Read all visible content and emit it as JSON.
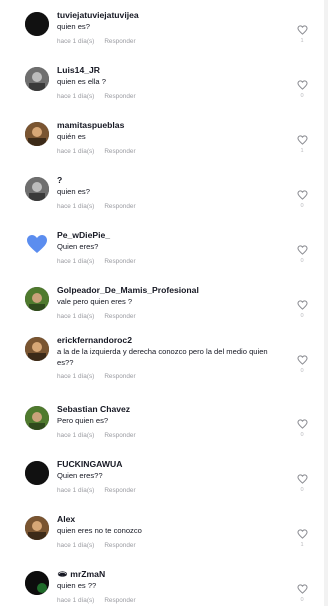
{
  "comments": [
    {
      "username": "tuviejatuviejatuvijea",
      "text": "quien es?",
      "time": "hace 1 día(s)",
      "reply": "Responder",
      "likes": "1",
      "avatar": "dark"
    },
    {
      "username": "Luis14_JR",
      "text": "quien es ella ?",
      "time": "hace 1 día(s)",
      "reply": "Responder",
      "likes": "0",
      "avatar": "photo-gray"
    },
    {
      "username": "mamitaspueblas",
      "text": "quién es",
      "time": "hace 1 día(s)",
      "reply": "Responder",
      "likes": "1",
      "avatar": "photo-brown"
    },
    {
      "username": "?",
      "text": "quien es?",
      "time": "hace 1 día(s)",
      "reply": "Responder",
      "likes": "0",
      "avatar": "photo-gray"
    },
    {
      "username": "Pe_wDiePie_",
      "text": "Quien eres?",
      "time": "hace 1 día(s)",
      "reply": "Responder",
      "likes": "0",
      "avatar": "heart-blue"
    },
    {
      "username": "Golpeador_De_Mamis_Profesional",
      "text": "vale pero quien eres ?",
      "time": "hace 1 día(s)",
      "reply": "Responder",
      "likes": "0",
      "avatar": "photo-green"
    },
    {
      "username": "erickfernandoroc2",
      "text": "a la de la izquierda y derecha conozco pero la del medio quien es??",
      "time": "hace 1 día(s)",
      "reply": "Responder",
      "likes": "0",
      "avatar": "photo-brown"
    },
    {
      "username": "Sebastian Chavez",
      "text": "Pero quien es?",
      "time": "hace 1 día(s)",
      "reply": "Responder",
      "likes": "0",
      "avatar": "photo-green"
    },
    {
      "username": "FUCKINGAWUA",
      "text": "Quien eres??",
      "time": "hace 1 día(s)",
      "reply": "Responder",
      "likes": "0",
      "avatar": "dark"
    },
    {
      "username": "Alex",
      "text": "quien eres no te conozco",
      "time": "hace 1 día(s)",
      "reply": "Responder",
      "likes": "1",
      "avatar": "photo-brown"
    },
    {
      "username": "🕳 mrZmaN",
      "text": "quien es ??",
      "time": "hace 1 día(s)",
      "reply": "Responder",
      "likes": "0",
      "avatar": "dark-green"
    }
  ],
  "colors": {
    "text": "#161823",
    "meta": "#9a9ba1",
    "heart_outline": "#8a8b91",
    "count": "#b8b9bd",
    "blue_heart": "#5b8def"
  },
  "icons": {
    "like": "heart-outline-icon"
  }
}
